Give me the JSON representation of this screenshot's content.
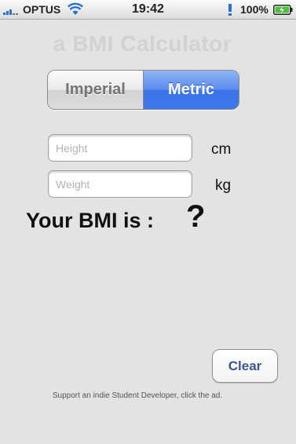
{
  "status_bar": {
    "carrier": "OPTUS",
    "time": "19:42",
    "battery_percent": "100%",
    "signal_icon": "signal-bars-icon",
    "wifi_icon": "wifi-icon",
    "bluetooth_icon": "bluetooth-icon",
    "battery_icon": "battery-charging-icon"
  },
  "title": "a BMI Calculator",
  "units_toggle": {
    "imperial_label": "Imperial",
    "metric_label": "Metric",
    "selected": "Metric",
    "selected_color": "#3c78ec"
  },
  "height_input": {
    "placeholder": "Height",
    "value": "",
    "unit": "cm"
  },
  "weight_input": {
    "placeholder": "Weight",
    "value": "",
    "unit": "kg"
  },
  "result": {
    "label": "Your BMI is :",
    "value": "?"
  },
  "clear_button": {
    "label": "Clear",
    "color": "#3a5690"
  },
  "footer_text": "Support an indie Student Developer, click the ad."
}
